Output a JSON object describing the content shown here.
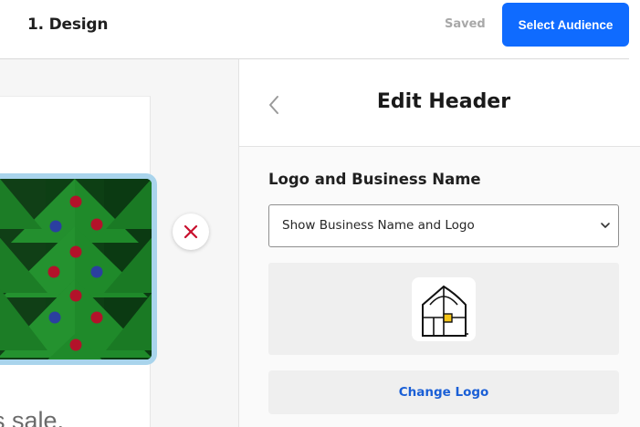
{
  "header": {
    "step_title": "1. Design",
    "save_status": "Saved",
    "primary_button": "Select Audience"
  },
  "canvas": {
    "sale_text": "s sale.",
    "image_description_icon": "christmas-tree-pattern",
    "remove_icon": "close-icon"
  },
  "panel": {
    "title": "Edit Header",
    "back_icon": "chevron-left-icon",
    "section_label": "Logo and Business Name",
    "select": {
      "value": "Show Business Name and Logo",
      "icon": "chevron-down-icon"
    },
    "logo_icon": "house-logo-icon",
    "change_logo_button": "Change Logo"
  },
  "colors": {
    "primary": "#0f6bff",
    "link": "#1a5fd6",
    "remove": "#c8102e",
    "frame_selected": "#a9d4ec",
    "logo_accent": "#f5c518"
  }
}
